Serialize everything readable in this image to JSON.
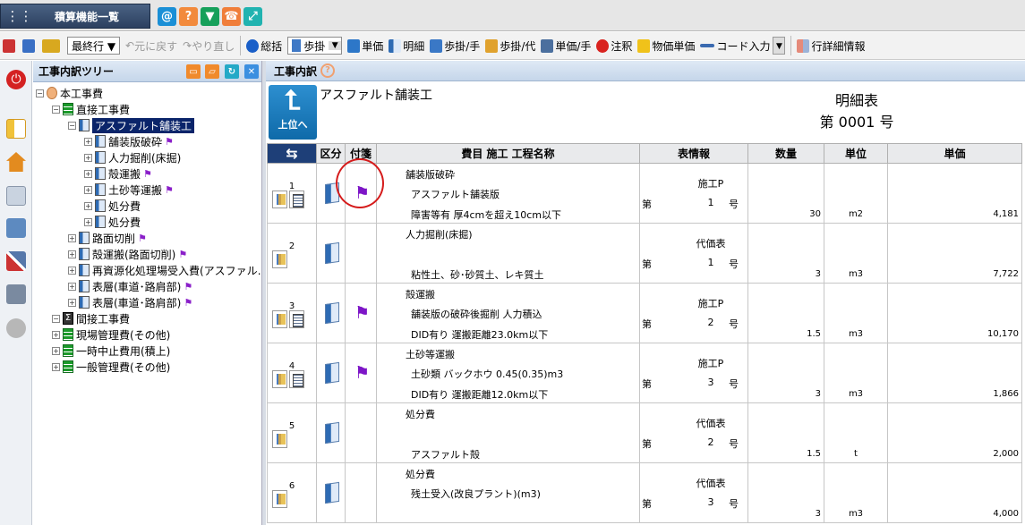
{
  "app": {
    "title": "積算機能一覧",
    "grid_icon": "grid-icon"
  },
  "top_icons": [
    {
      "name": "at-icon",
      "glyph": "@",
      "color": "#1a8fd6"
    },
    {
      "name": "help-icon",
      "glyph": "?",
      "color": "#f28a3c"
    },
    {
      "name": "beginner-icon",
      "glyph": "▼",
      "color": "#16a05a"
    },
    {
      "name": "support-icon",
      "glyph": "☎",
      "color": "#f07e3a"
    },
    {
      "name": "expand-icon",
      "glyph": "⤢",
      "color": "#21b3b0"
    }
  ],
  "toolbar": {
    "filter": "最終行 ▼",
    "undo": "元に戻す",
    "redo": "やり直し",
    "summary": "総括",
    "step_combo": "歩掛",
    "unit_price": "単価",
    "detail": "明細",
    "step_hand": "歩掛/手",
    "step_proxy": "歩掛/代",
    "unit_hand": "単価/手",
    "note": "注釈",
    "item_unit_price": "物価単価",
    "code_input": "コード入力",
    "row_detail": "行詳細情報"
  },
  "tree": {
    "header": "工事内訳ツリー",
    "nodes": [
      {
        "label": "本工事費",
        "level": 0,
        "icon": "person"
      },
      {
        "label": "直接工事費",
        "level": 1,
        "icon": "green"
      },
      {
        "label": "アスファルト舗装工",
        "level": 2,
        "icon": "doc",
        "selected": true
      },
      {
        "label": "舗装版破砕",
        "level": 3,
        "icon": "doc",
        "flag": true
      },
      {
        "label": "人力掘削(床掘)",
        "level": 3,
        "icon": "doc"
      },
      {
        "label": "殻運搬",
        "level": 3,
        "icon": "doc",
        "flag": true
      },
      {
        "label": "土砂等運搬",
        "level": 3,
        "icon": "doc",
        "flag": true
      },
      {
        "label": "処分費",
        "level": 3,
        "icon": "doc"
      },
      {
        "label": "処分費",
        "level": 3,
        "icon": "doc"
      },
      {
        "label": "路面切削",
        "level": 2,
        "icon": "doc",
        "flag": true
      },
      {
        "label": "殻運搬(路面切削)",
        "level": 2,
        "icon": "doc",
        "flag": true
      },
      {
        "label": "再資源化処理場受入費(アスファル…",
        "level": 2,
        "icon": "doc"
      },
      {
        "label": "表層(車道･路肩部)",
        "level": 2,
        "icon": "doc",
        "flag": true
      },
      {
        "label": "表層(車道･路肩部)",
        "level": 2,
        "icon": "doc",
        "flag": true
      },
      {
        "label": "間接工事費",
        "level": 1,
        "icon": "sigma"
      },
      {
        "label": "現場管理費(その他)",
        "level": 1,
        "icon": "green"
      },
      {
        "label": "一時中止費用(積上)",
        "level": 1,
        "icon": "green"
      },
      {
        "label": "一般管理費(その他)",
        "level": 1,
        "icon": "green"
      }
    ]
  },
  "main": {
    "header": "工事内訳",
    "up_label": "上位へ",
    "work_name": "アスファルト舗装工",
    "sheet_title": "明細表",
    "sheet_number": "第 0001 号",
    "columns": [
      "区分",
      "付箋",
      "費目  施工  工程名称",
      "表情報",
      "数量",
      "単位",
      "単価"
    ],
    "rows": [
      {
        "no": "1",
        "name1": "舗装版破砕",
        "name2": "アスファルト舗装版",
        "name3": "障害等有  厚4cmを超え10cm以下",
        "tbl": "施工P",
        "dai": "第",
        "num": "1",
        "go": "号",
        "qty": "30",
        "unit": "m2",
        "price": "4,181",
        "flag": true,
        "doc": true
      },
      {
        "no": "2",
        "name1": "人力掘削(床掘)",
        "name2": "",
        "name3": "粘性土、砂･砂質土、レキ質土",
        "tbl": "代価表",
        "dai": "第",
        "num": "1",
        "go": "号",
        "qty": "3",
        "unit": "m3",
        "price": "7,722",
        "flag": false,
        "doc": false
      },
      {
        "no": "3",
        "name1": "殻運搬",
        "name2": "舗装版の破砕後掘削  人力積込",
        "name3": "DID有り  運搬距離23.0km以下",
        "tbl": "施工P",
        "dai": "第",
        "num": "2",
        "go": "号",
        "qty": "1.5",
        "unit": "m3",
        "price": "10,170",
        "flag": true,
        "doc": true
      },
      {
        "no": "4",
        "name1": "土砂等運搬",
        "name2": "土砂類  バックホウ 0.45(0.35)m3",
        "name3": "DID有り  運搬距離12.0km以下",
        "tbl": "施工P",
        "dai": "第",
        "num": "3",
        "go": "号",
        "qty": "3",
        "unit": "m3",
        "price": "1,866",
        "flag": true,
        "doc": true
      },
      {
        "no": "5",
        "name1": "処分費",
        "name2": "",
        "name3": "アスファルト殻",
        "tbl": "代価表",
        "dai": "第",
        "num": "2",
        "go": "号",
        "qty": "1.5",
        "unit": "t",
        "price": "2,000",
        "flag": false,
        "doc": false
      },
      {
        "no": "6",
        "name1": "処分費",
        "name2": "残土受入(改良プラント)(m3)",
        "name3": "",
        "tbl": "代価表",
        "dai": "第",
        "num": "3",
        "go": "号",
        "qty": "3",
        "unit": "m3",
        "price": "4,000",
        "flag": false,
        "doc": false
      }
    ]
  }
}
